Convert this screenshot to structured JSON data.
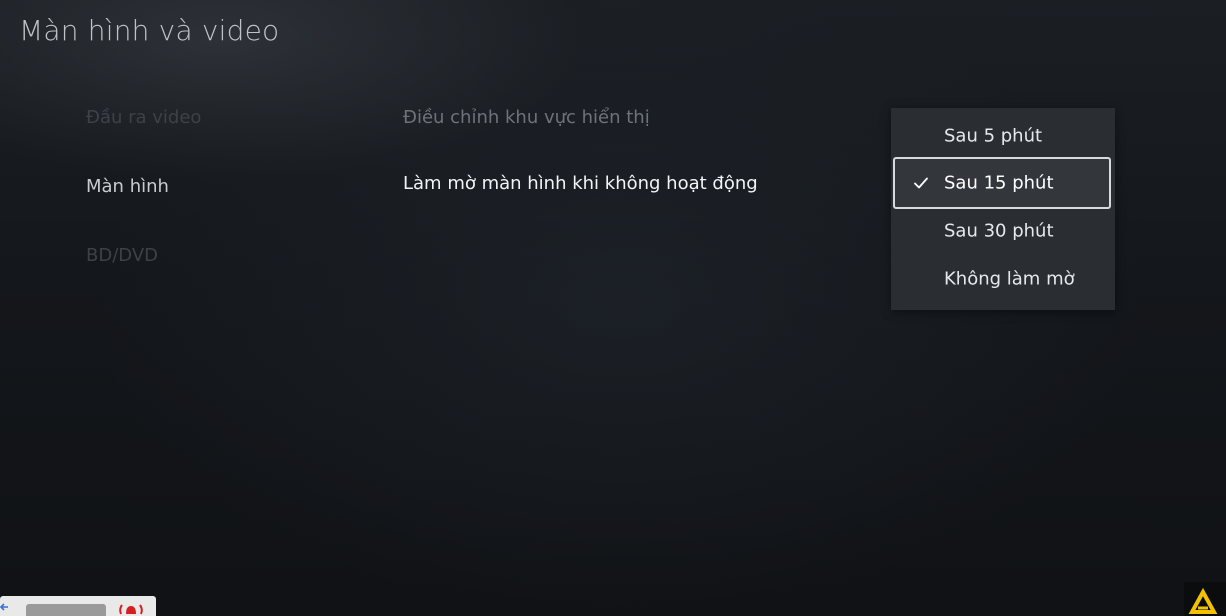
{
  "header": {
    "title": "Màn hình và video"
  },
  "sidebar": {
    "items": [
      {
        "label": "Đầu ra video",
        "active": false
      },
      {
        "label": "Màn hình",
        "active": true
      },
      {
        "label": "BD/DVD",
        "active": false
      }
    ]
  },
  "main": {
    "settings": [
      {
        "label": "Điều chỉnh khu vực hiển thị"
      },
      {
        "label": "Làm mờ màn hình khi không hoạt động"
      }
    ]
  },
  "dropdown": {
    "selected_index": 1,
    "options": [
      {
        "label": "Sau 5 phút"
      },
      {
        "label": "Sau 15 phút"
      },
      {
        "label": "Sau 30 phút"
      },
      {
        "label": "Không làm mờ"
      }
    ]
  },
  "icons": {
    "check": "check-icon",
    "back_arrow": "arrow-left-icon",
    "bell": "bell-icon",
    "logo": "triangle-logo-icon"
  },
  "colors": {
    "background": "#15181c",
    "dropdown_bg": "#2a2e33",
    "selected_border": "#d8dbde",
    "logo_yellow": "#f2c200",
    "bell_red": "#d42020"
  }
}
